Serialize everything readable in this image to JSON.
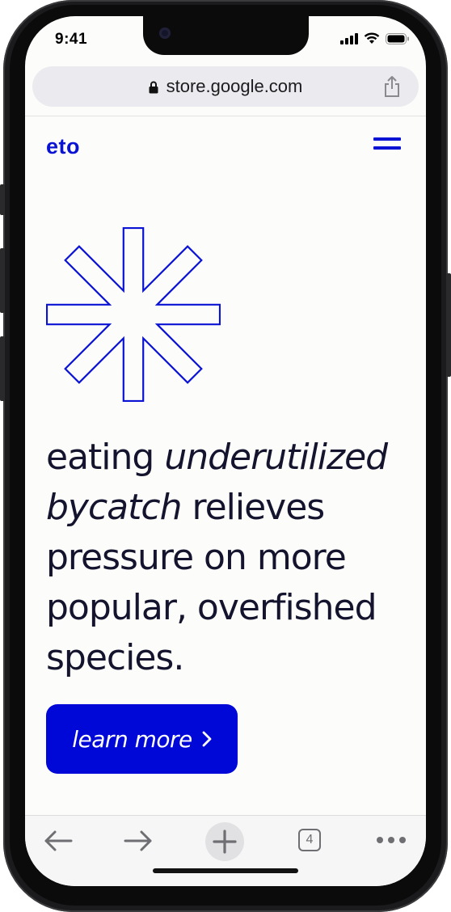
{
  "status_bar": {
    "time": "9:41"
  },
  "browser": {
    "url": "store.google.com",
    "tab_count": "4"
  },
  "site": {
    "logo": "eto",
    "headline_part1": "eating ",
    "headline_italic": "underutilized bycatch",
    "headline_part2": " relieves pressure on more popular, overfished species.",
    "cta_label": "learn more",
    "cta_chevron": "›"
  },
  "colors": {
    "brand_blue": "#0a12d4",
    "cta_blue": "#0008d8",
    "headline_text": "#14142e",
    "page_bg": "#fcfcfa"
  },
  "icons": {
    "lock": "lock-icon",
    "share": "share-icon",
    "menu": "hamburger-menu-icon",
    "back": "back-arrow-icon",
    "forward": "forward-arrow-icon",
    "new_tab": "plus-icon",
    "tabs": "tabs-icon",
    "more": "more-dots-icon"
  }
}
